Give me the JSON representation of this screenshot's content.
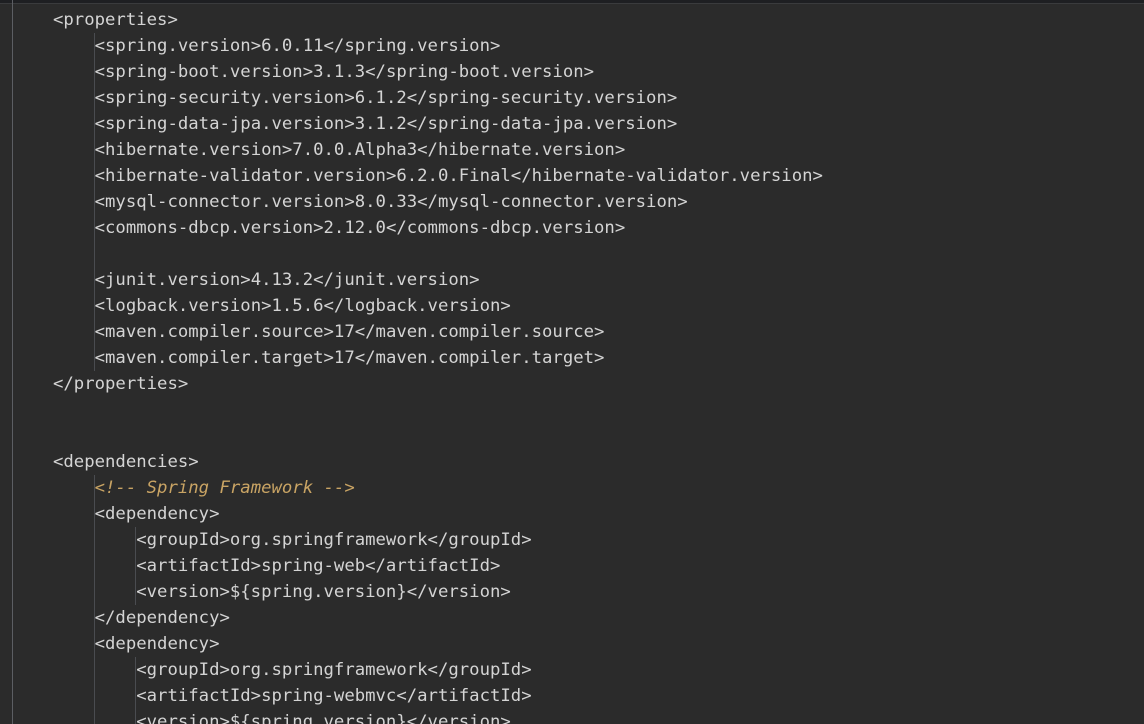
{
  "editor": {
    "lines": [
      {
        "indent": 0,
        "text": "<properties>"
      },
      {
        "indent": 1,
        "text": "<spring.version>6.0.11</spring.version>"
      },
      {
        "indent": 1,
        "text": "<spring-boot.version>3.1.3</spring-boot.version>"
      },
      {
        "indent": 1,
        "text": "<spring-security.version>6.1.2</spring-security.version>"
      },
      {
        "indent": 1,
        "text": "<spring-data-jpa.version>3.1.2</spring-data-jpa.version>"
      },
      {
        "indent": 1,
        "text": "<hibernate.version>7.0.0.Alpha3</hibernate.version>"
      },
      {
        "indent": 1,
        "text": "<hibernate-validator.version>6.2.0.Final</hibernate-validator.version>"
      },
      {
        "indent": 1,
        "text": "<mysql-connector.version>8.0.33</mysql-connector.version>"
      },
      {
        "indent": 1,
        "text": "<commons-dbcp.version>2.12.0</commons-dbcp.version>"
      },
      {
        "indent": 0,
        "text": ""
      },
      {
        "indent": 1,
        "text": "<junit.version>4.13.2</junit.version>"
      },
      {
        "indent": 1,
        "text": "<logback.version>1.5.6</logback.version>"
      },
      {
        "indent": 1,
        "text": "<maven.compiler.source>17</maven.compiler.source>"
      },
      {
        "indent": 1,
        "text": "<maven.compiler.target>17</maven.compiler.target>"
      },
      {
        "indent": 0,
        "text": "</properties>"
      },
      {
        "indent": 0,
        "text": ""
      },
      {
        "indent": 0,
        "text": ""
      },
      {
        "indent": 0,
        "text": "<dependencies>"
      },
      {
        "indent": 1,
        "text": "<!-- Spring Framework -->",
        "kind": "comment"
      },
      {
        "indent": 1,
        "text": "<dependency>"
      },
      {
        "indent": 2,
        "text": "<groupId>org.springframework</groupId>"
      },
      {
        "indent": 2,
        "text": "<artifactId>spring-web</artifactId>"
      },
      {
        "indent": 2,
        "text": "<version>${spring.version}</version>"
      },
      {
        "indent": 1,
        "text": "</dependency>"
      },
      {
        "indent": 1,
        "text": "<dependency>"
      },
      {
        "indent": 2,
        "text": "<groupId>org.springframework</groupId>"
      },
      {
        "indent": 2,
        "text": "<artifactId>spring-webmvc</artifactId>"
      },
      {
        "indent": 2,
        "text": "<version>${spring.version}</version>"
      }
    ]
  },
  "colors": {
    "background": "#2b2b2b",
    "text": "#d4d4d4",
    "comment": "#c9a464",
    "indent_guide": "#4a4c50"
  }
}
